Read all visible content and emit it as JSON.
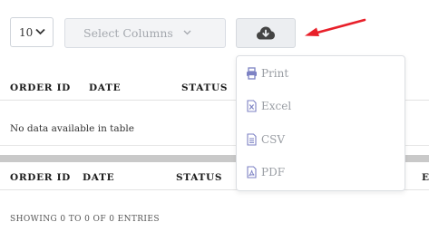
{
  "toolbar": {
    "page_length_value": "10",
    "select_columns_placeholder": "Select Columns",
    "export_icon": "cloud-download-icon"
  },
  "export_menu": {
    "items": [
      {
        "label": "Print",
        "icon": "printer-icon"
      },
      {
        "label": "Excel",
        "icon": "excel-file-icon"
      },
      {
        "label": "CSV",
        "icon": "csv-file-icon"
      },
      {
        "label": "PDF",
        "icon": "pdf-file-icon"
      }
    ]
  },
  "table": {
    "columns": [
      "ORDER ID",
      "DATE",
      "STATUS",
      "E"
    ],
    "empty_message": "No data available in table",
    "info": "SHOWING 0 TO 0 OF 0 ENTRIES"
  },
  "colors": {
    "arrow": "#e8202a",
    "menu_icon": "#7d82c4",
    "scroll_band": "#c9c9c9"
  }
}
